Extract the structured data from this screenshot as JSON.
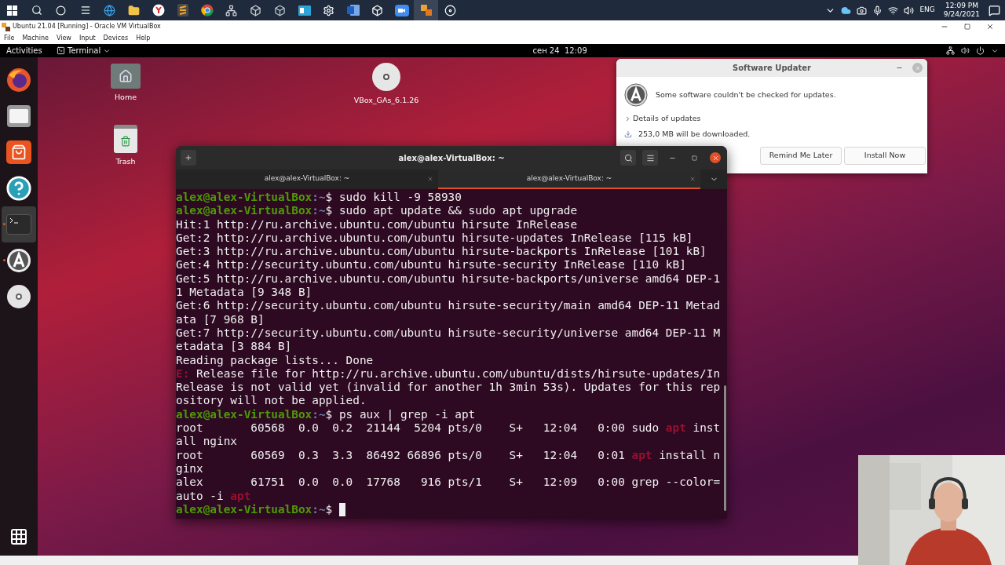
{
  "host_taskbar": {
    "language": "ENG",
    "time": "12:09 PM",
    "date": "9/24/2021"
  },
  "vm_window": {
    "title": "Ubuntu 21.04 [Running] - Oracle VM VirtualBox",
    "menu": [
      "File",
      "Machine",
      "View",
      "Input",
      "Devices",
      "Help"
    ]
  },
  "top_bar": {
    "activities": "Activities",
    "app": "Terminal",
    "clock": "сен 24  12:09"
  },
  "dock": {
    "items": [
      {
        "kind": "browser",
        "running": false,
        "focused": false
      },
      {
        "kind": "files",
        "running": false,
        "focused": false
      },
      {
        "kind": "software",
        "running": false,
        "focused": false
      },
      {
        "kind": "help",
        "running": false,
        "focused": false
      },
      {
        "kind": "terminal",
        "running": true,
        "focused": true
      },
      {
        "kind": "updater",
        "running": true,
        "focused": false
      },
      {
        "kind": "disc",
        "running": false,
        "focused": false
      }
    ]
  },
  "desktop_icons": [
    {
      "kind": "home",
      "label": "Home"
    },
    {
      "kind": "trash",
      "label": "Trash"
    },
    {
      "kind": "disc",
      "label": "VBox_GAs_6.1.26"
    }
  ],
  "software_updater": {
    "title": "Software Updater",
    "message": "Some software couldn't be checked for updates.",
    "details": "Details of updates",
    "expanded": false,
    "download": "253,0 MB will be downloaded.",
    "buttons": [
      "Remind Me Later",
      "Install Now"
    ]
  },
  "terminal": {
    "title": "alex@alex-VirtualBox: ~",
    "tabs": [
      {
        "label": "alex@alex-VirtualBox: ~",
        "selected": false
      },
      {
        "label": "alex@alex-VirtualBox: ~",
        "selected": true
      }
    ],
    "cursor_visible": true,
    "lines": [
      [
        {
          "kind": "user",
          "text": "alex@alex-VirtualBox"
        },
        {
          "kind": "path",
          "text": ":~"
        },
        {
          "kind": "text",
          "text": "$ sudo kill -9 58930"
        }
      ],
      [
        {
          "kind": "user",
          "text": "alex@alex-VirtualBox"
        },
        {
          "kind": "path",
          "text": ":~"
        },
        {
          "kind": "text",
          "text": "$ sudo apt update && sudo apt upgrade"
        }
      ],
      [
        {
          "kind": "text",
          "text": "Hit:1 http://ru.archive.ubuntu.com/ubuntu hirsute InRelease"
        }
      ],
      [
        {
          "kind": "text",
          "text": "Get:2 http://ru.archive.ubuntu.com/ubuntu hirsute-updates InRelease [115 kB]"
        }
      ],
      [
        {
          "kind": "text",
          "text": "Get:3 http://ru.archive.ubuntu.com/ubuntu hirsute-backports InRelease [101 kB]"
        }
      ],
      [
        {
          "kind": "text",
          "text": "Get:4 http://security.ubuntu.com/ubuntu hirsute-security InRelease [110 kB]"
        }
      ],
      [
        {
          "kind": "text",
          "text": "Get:5 http://ru.archive.ubuntu.com/ubuntu hirsute-backports/universe amd64 DEP-1"
        }
      ],
      [
        {
          "kind": "text",
          "text": "1 Metadata [9 348 B]"
        }
      ],
      [
        {
          "kind": "text",
          "text": "Get:6 http://security.ubuntu.com/ubuntu hirsute-security/main amd64 DEP-11 Metad"
        }
      ],
      [
        {
          "kind": "text",
          "text": "ata [7 968 B]"
        }
      ],
      [
        {
          "kind": "text",
          "text": "Get:7 http://security.ubuntu.com/ubuntu hirsute-security/universe amd64 DEP-11 M"
        }
      ],
      [
        {
          "kind": "text",
          "text": "etadata [3 884 B]"
        }
      ],
      [
        {
          "kind": "text",
          "text": "Reading package lists... Done"
        }
      ],
      [
        {
          "kind": "error",
          "text": "E:"
        },
        {
          "kind": "text",
          "text": " Release file for http://ru.archive.ubuntu.com/ubuntu/dists/hirsute-updates/In"
        }
      ],
      [
        {
          "kind": "text",
          "text": "Release is not valid yet (invalid for another 1h 3min 53s). Updates for this rep"
        }
      ],
      [
        {
          "kind": "text",
          "text": "ository will not be applied."
        }
      ],
      [
        {
          "kind": "user",
          "text": "alex@alex-VirtualBox"
        },
        {
          "kind": "path",
          "text": ":~"
        },
        {
          "kind": "text",
          "text": "$ ps aux | grep -i apt"
        }
      ],
      [
        {
          "kind": "text",
          "text": "root       60568  0.0  0.2  21144  5204 pts/0    S+   12:04   0:00 sudo "
        },
        {
          "kind": "match",
          "text": "apt"
        },
        {
          "kind": "text",
          "text": " inst"
        }
      ],
      [
        {
          "kind": "text",
          "text": "all nginx"
        }
      ],
      [
        {
          "kind": "text",
          "text": "root       60569  0.3  3.3  86492 66896 pts/0    S+   12:04   0:01 "
        },
        {
          "kind": "match",
          "text": "apt"
        },
        {
          "kind": "text",
          "text": " install n"
        }
      ],
      [
        {
          "kind": "text",
          "text": "ginx"
        }
      ],
      [
        {
          "kind": "text",
          "text": "alex       61751  0.0  0.0  17768   916 pts/1    S+   12:09   0:00 grep --color="
        }
      ],
      [
        {
          "kind": "text",
          "text": "auto -i "
        },
        {
          "kind": "match",
          "text": "apt"
        }
      ],
      [
        {
          "kind": "user",
          "text": "alex@alex-VirtualBox"
        },
        {
          "kind": "path",
          "text": ":~"
        },
        {
          "kind": "text",
          "text": "$ "
        }
      ]
    ]
  }
}
